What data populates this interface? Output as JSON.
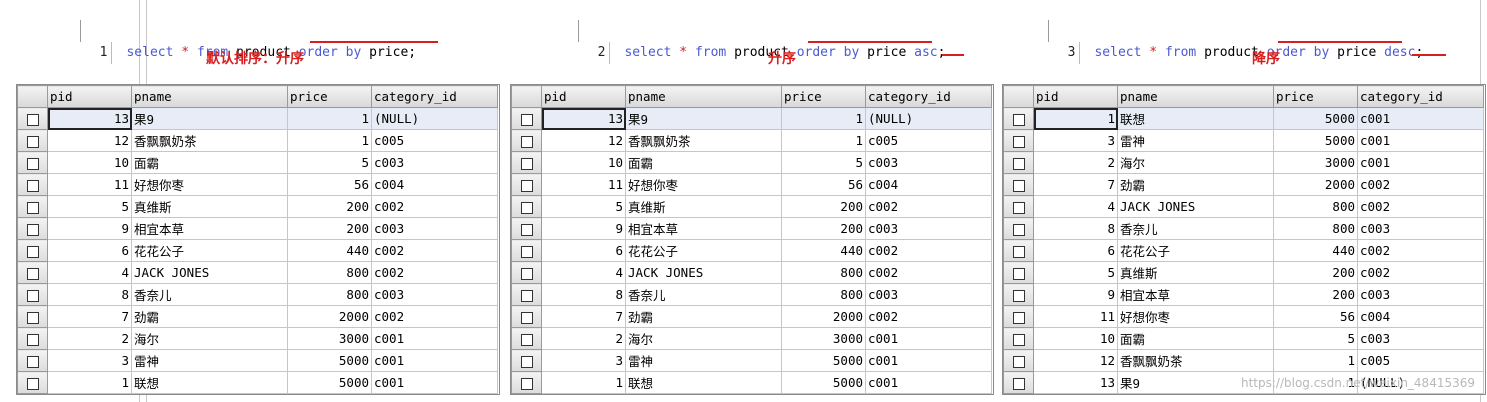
{
  "queries": [
    {
      "line": "1",
      "kw1": "select",
      "star": "*",
      "kw2": "from",
      "table": "product",
      "kw3": "order by",
      "col": "price",
      "dir": "",
      "end": ";",
      "note": "默认排序：升序"
    },
    {
      "line": "2",
      "kw1": "select",
      "star": "*",
      "kw2": "from",
      "table": "product",
      "kw3": "order by",
      "col": "price",
      "dir": "asc",
      "end": ";",
      "note": "升序"
    },
    {
      "line": "3",
      "kw1": "select",
      "star": "*",
      "kw2": "from",
      "table": "product",
      "kw3": "order by",
      "col": "price",
      "dir": "desc",
      "end": ";",
      "note": "降序"
    }
  ],
  "columns": [
    "pid",
    "pname",
    "price",
    "category_id"
  ],
  "grids": [
    {
      "rows": [
        [
          "13",
          "果9",
          "1",
          "(NULL)"
        ],
        [
          "12",
          "香飘飘奶茶",
          "1",
          "c005"
        ],
        [
          "10",
          "面霸",
          "5",
          "c003"
        ],
        [
          "11",
          "好想你枣",
          "56",
          "c004"
        ],
        [
          "5",
          "真维斯",
          "200",
          "c002"
        ],
        [
          "9",
          "相宜本草",
          "200",
          "c003"
        ],
        [
          "6",
          "花花公子",
          "440",
          "c002"
        ],
        [
          "4",
          "JACK JONES",
          "800",
          "c002"
        ],
        [
          "8",
          "香奈儿",
          "800",
          "c003"
        ],
        [
          "7",
          "劲霸",
          "2000",
          "c002"
        ],
        [
          "2",
          "海尔",
          "3000",
          "c001"
        ],
        [
          "3",
          "雷神",
          "5000",
          "c001"
        ],
        [
          "1",
          "联想",
          "5000",
          "c001"
        ]
      ]
    },
    {
      "rows": [
        [
          "13",
          "果9",
          "1",
          "(NULL)"
        ],
        [
          "12",
          "香飘飘奶茶",
          "1",
          "c005"
        ],
        [
          "10",
          "面霸",
          "5",
          "c003"
        ],
        [
          "11",
          "好想你枣",
          "56",
          "c004"
        ],
        [
          "5",
          "真维斯",
          "200",
          "c002"
        ],
        [
          "9",
          "相宜本草",
          "200",
          "c003"
        ],
        [
          "6",
          "花花公子",
          "440",
          "c002"
        ],
        [
          "4",
          "JACK JONES",
          "800",
          "c002"
        ],
        [
          "8",
          "香奈儿",
          "800",
          "c003"
        ],
        [
          "7",
          "劲霸",
          "2000",
          "c002"
        ],
        [
          "2",
          "海尔",
          "3000",
          "c001"
        ],
        [
          "3",
          "雷神",
          "5000",
          "c001"
        ],
        [
          "1",
          "联想",
          "5000",
          "c001"
        ]
      ]
    },
    {
      "rows": [
        [
          "1",
          "联想",
          "5000",
          "c001"
        ],
        [
          "3",
          "雷神",
          "5000",
          "c001"
        ],
        [
          "2",
          "海尔",
          "3000",
          "c001"
        ],
        [
          "7",
          "劲霸",
          "2000",
          "c002"
        ],
        [
          "4",
          "JACK JONES",
          "800",
          "c002"
        ],
        [
          "8",
          "香奈儿",
          "800",
          "c003"
        ],
        [
          "6",
          "花花公子",
          "440",
          "c002"
        ],
        [
          "5",
          "真维斯",
          "200",
          "c002"
        ],
        [
          "9",
          "相宜本草",
          "200",
          "c003"
        ],
        [
          "11",
          "好想你枣",
          "56",
          "c004"
        ],
        [
          "10",
          "面霸",
          "5",
          "c003"
        ],
        [
          "12",
          "香飘飘奶茶",
          "1",
          "c005"
        ],
        [
          "13",
          "果9",
          "1",
          "(NULL)"
        ]
      ]
    }
  ],
  "watermark": "https://blog.csdn.net/weixin_48415369"
}
